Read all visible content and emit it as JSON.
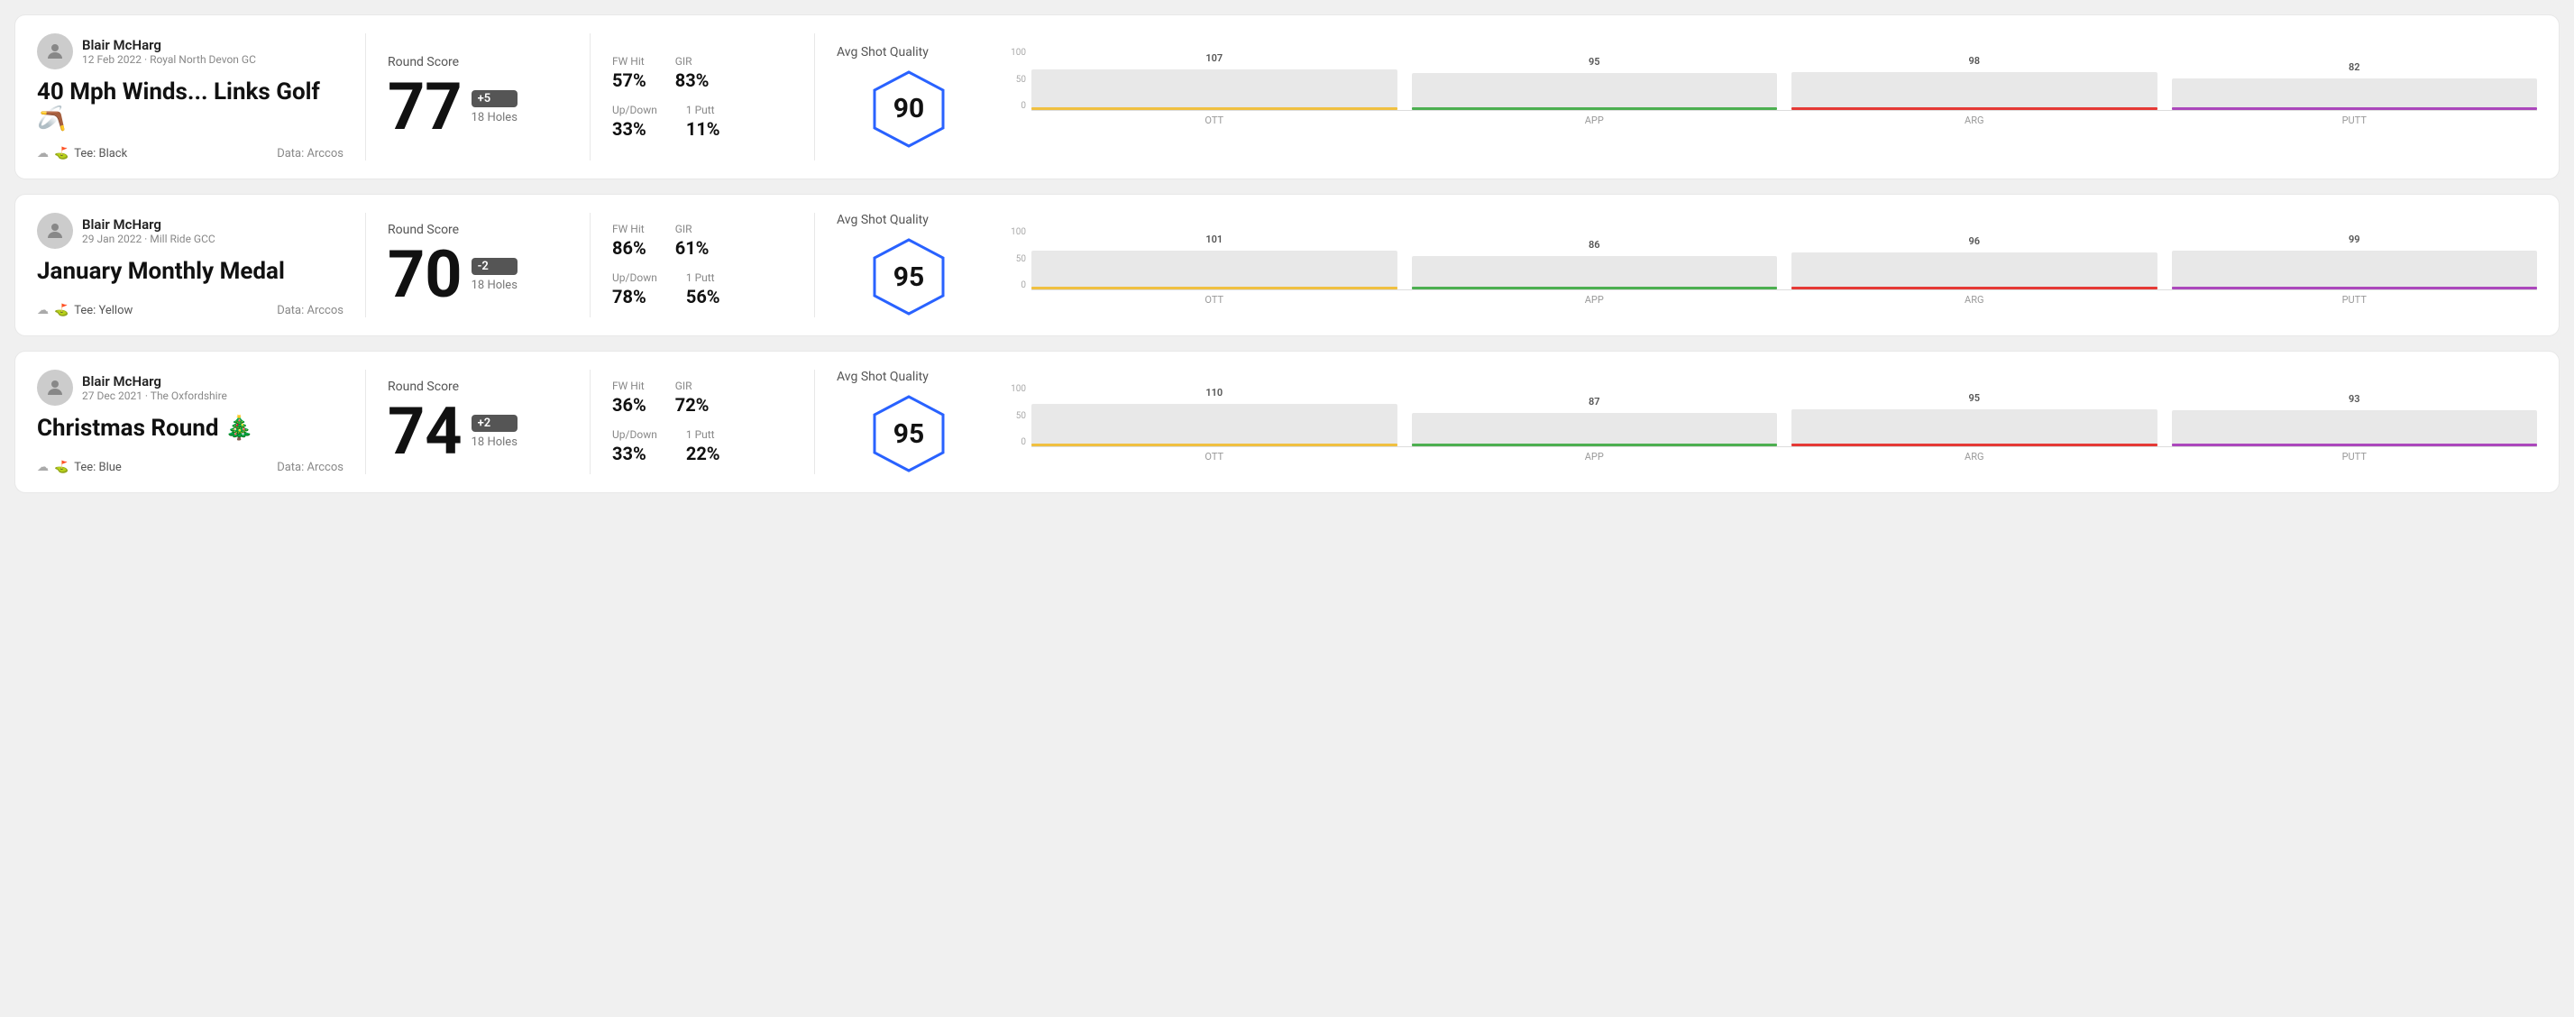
{
  "cards": [
    {
      "id": "card-1",
      "user": {
        "name": "Blair McHarg",
        "date": "12 Feb 2022 · Royal North Devon GC"
      },
      "title": "40 Mph Winds... Links Golf 🪃",
      "tee": "Black",
      "dataSource": "Data: Arccos",
      "score": {
        "label": "Round Score",
        "number": "77",
        "badge": "+5",
        "holes": "18 Holes"
      },
      "stats": {
        "fw_hit_label": "FW Hit",
        "fw_hit_value": "57%",
        "gir_label": "GIR",
        "gir_value": "83%",
        "updown_label": "Up/Down",
        "updown_value": "33%",
        "oneputt_label": "1 Putt",
        "oneputt_value": "11%"
      },
      "quality": {
        "label": "Avg Shot Quality",
        "score": "90"
      },
      "chart": {
        "bars": [
          {
            "label": "OTT",
            "value": 107,
            "color": "#f0c040",
            "pct": 65
          },
          {
            "label": "APP",
            "value": 95,
            "color": "#4caf50",
            "pct": 58
          },
          {
            "label": "ARG",
            "value": 98,
            "color": "#e53935",
            "pct": 60
          },
          {
            "label": "PUTT",
            "value": 82,
            "color": "#ab47bc",
            "pct": 50
          }
        ]
      }
    },
    {
      "id": "card-2",
      "user": {
        "name": "Blair McHarg",
        "date": "29 Jan 2022 · Mill Ride GCC"
      },
      "title": "January Monthly Medal",
      "tee": "Yellow",
      "dataSource": "Data: Arccos",
      "score": {
        "label": "Round Score",
        "number": "70",
        "badge": "-2",
        "holes": "18 Holes"
      },
      "stats": {
        "fw_hit_label": "FW Hit",
        "fw_hit_value": "86%",
        "gir_label": "GIR",
        "gir_value": "61%",
        "updown_label": "Up/Down",
        "updown_value": "78%",
        "oneputt_label": "1 Putt",
        "oneputt_value": "56%"
      },
      "quality": {
        "label": "Avg Shot Quality",
        "score": "95"
      },
      "chart": {
        "bars": [
          {
            "label": "OTT",
            "value": 101,
            "color": "#f0c040",
            "pct": 62
          },
          {
            "label": "APP",
            "value": 86,
            "color": "#4caf50",
            "pct": 53
          },
          {
            "label": "ARG",
            "value": 96,
            "color": "#e53935",
            "pct": 59
          },
          {
            "label": "PUTT",
            "value": 99,
            "color": "#ab47bc",
            "pct": 61
          }
        ]
      }
    },
    {
      "id": "card-3",
      "user": {
        "name": "Blair McHarg",
        "date": "27 Dec 2021 · The Oxfordshire"
      },
      "title": "Christmas Round 🎄",
      "tee": "Blue",
      "dataSource": "Data: Arccos",
      "score": {
        "label": "Round Score",
        "number": "74",
        "badge": "+2",
        "holes": "18 Holes"
      },
      "stats": {
        "fw_hit_label": "FW Hit",
        "fw_hit_value": "36%",
        "gir_label": "GIR",
        "gir_value": "72%",
        "updown_label": "Up/Down",
        "updown_value": "33%",
        "oneputt_label": "1 Putt",
        "oneputt_value": "22%"
      },
      "quality": {
        "label": "Avg Shot Quality",
        "score": "95"
      },
      "chart": {
        "bars": [
          {
            "label": "OTT",
            "value": 110,
            "color": "#f0c040",
            "pct": 67
          },
          {
            "label": "APP",
            "value": 87,
            "color": "#4caf50",
            "pct": 53
          },
          {
            "label": "ARG",
            "value": 95,
            "color": "#e53935",
            "pct": 58
          },
          {
            "label": "PUTT",
            "value": 93,
            "color": "#ab47bc",
            "pct": 57
          }
        ]
      }
    }
  ],
  "y_axis": [
    "100",
    "50",
    "0"
  ]
}
